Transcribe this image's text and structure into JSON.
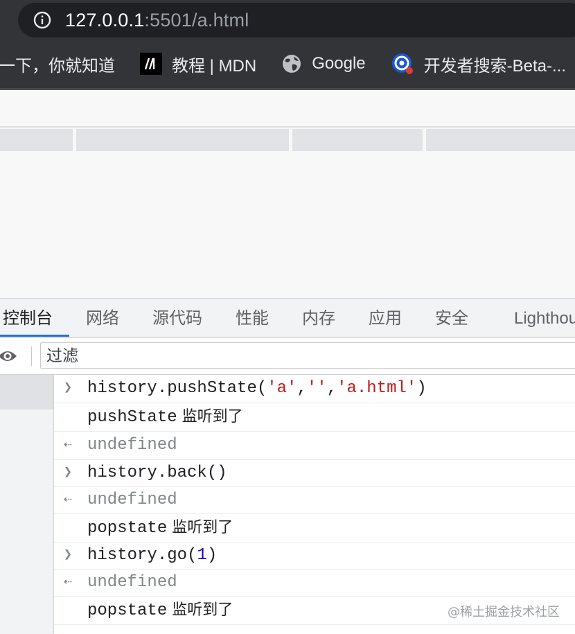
{
  "browser": {
    "url_host": "127.0.0.1",
    "url_rest": ":5501/a.html",
    "bookmarks": [
      {
        "label": "一下，你就知道",
        "icon": "none"
      },
      {
        "label": "教程 | MDN",
        "icon": "mdn-icon"
      },
      {
        "label": "Google",
        "icon": "globe-icon"
      },
      {
        "label": "开发者搜索-Beta-...",
        "icon": "devsearch-icon"
      }
    ]
  },
  "devtools": {
    "tabs": [
      "控制台",
      "网络",
      "源代码",
      "性能",
      "内存",
      "应用",
      "安全",
      "Lighthouse"
    ],
    "active_tab": "控制台",
    "filter_placeholder": "过滤"
  },
  "console": {
    "lines": [
      {
        "kind": "input",
        "pre": "history.pushState(",
        "s1": "'a'",
        "c1": ",",
        "s2": "''",
        "c2": ",",
        "s3": "'a.html'",
        "post": ")"
      },
      {
        "kind": "log",
        "code": "pushState",
        "cjk": " 监听到了"
      },
      {
        "kind": "result",
        "text": "undefined"
      },
      {
        "kind": "input",
        "text": "history.back()"
      },
      {
        "kind": "result",
        "text": "undefined"
      },
      {
        "kind": "log",
        "code": "popstate",
        "cjk": " 监听到了"
      },
      {
        "kind": "input",
        "pre": "history.go(",
        "n": "1",
        "post": ")"
      },
      {
        "kind": "result",
        "text": "undefined"
      },
      {
        "kind": "log",
        "code": "popstate",
        "cjk": " 监听到了"
      }
    ]
  },
  "watermark": "@稀土掘金技术社区",
  "colors": {
    "chrome_bg": "#333438",
    "address_bg": "#1f2023",
    "tab_active_underline": "#1a73e8",
    "string": "#c41a16",
    "number": "#1c00cf",
    "result_grey": "#80868b"
  }
}
